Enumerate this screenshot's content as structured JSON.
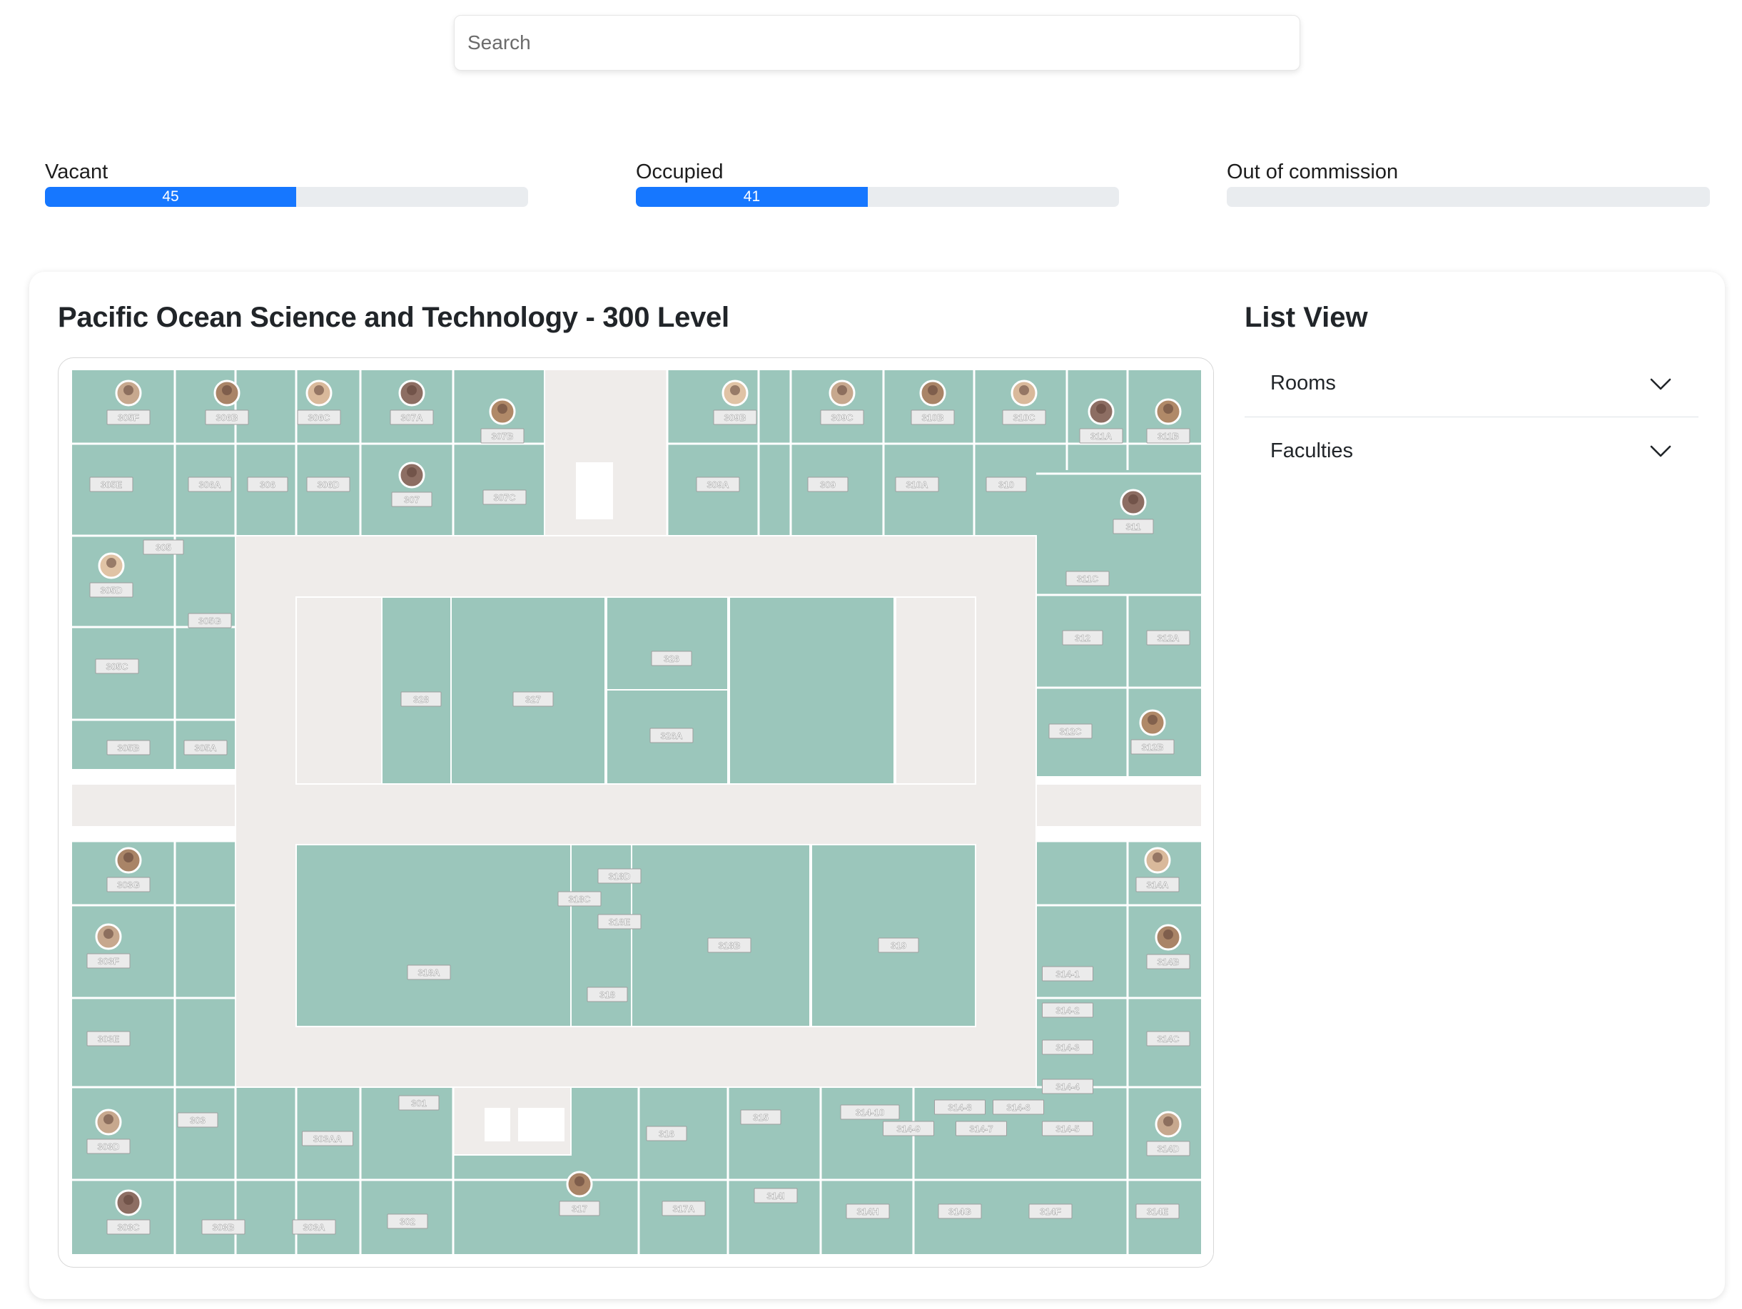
{
  "search": {
    "placeholder": "Search"
  },
  "stats": [
    {
      "label": "Vacant",
      "value": "45",
      "fraction": 0.52
    },
    {
      "label": "Occupied",
      "value": "41",
      "fraction": 0.48
    },
    {
      "label": "Out of commission",
      "value": "",
      "fraction": 0
    }
  ],
  "map": {
    "title": "Pacific Ocean Science and Technology - 300 Level"
  },
  "list_view": {
    "title": "List View",
    "items": [
      {
        "label": "Rooms"
      },
      {
        "label": "Faculties"
      }
    ]
  },
  "colors": {
    "room": "#9bc6bb",
    "corridor": "#efecea",
    "progress": "#1677ff",
    "track": "#e9ecef"
  },
  "rooms": [
    {
      "label": "305F",
      "avatar": true
    },
    {
      "label": "306B",
      "avatar": true
    },
    {
      "label": "306C",
      "avatar": true
    },
    {
      "label": "307A",
      "avatar": true
    },
    {
      "label": "307B",
      "avatar": true
    },
    {
      "label": "309B",
      "avatar": true
    },
    {
      "label": "309C",
      "avatar": true
    },
    {
      "label": "310B",
      "avatar": true
    },
    {
      "label": "310C",
      "avatar": true
    },
    {
      "label": "311A",
      "avatar": true
    },
    {
      "label": "311B",
      "avatar": true
    },
    {
      "label": "305E",
      "avatar": false
    },
    {
      "label": "306A",
      "avatar": false
    },
    {
      "label": "306",
      "avatar": false
    },
    {
      "label": "306D",
      "avatar": false
    },
    {
      "label": "307",
      "avatar": true
    },
    {
      "label": "307C",
      "avatar": false
    },
    {
      "label": "309A",
      "avatar": false
    },
    {
      "label": "309",
      "avatar": false
    },
    {
      "label": "310A",
      "avatar": false
    },
    {
      "label": "310",
      "avatar": false
    },
    {
      "label": "311",
      "avatar": true
    },
    {
      "label": "305",
      "avatar": false
    },
    {
      "label": "305D",
      "avatar": true
    },
    {
      "label": "311C",
      "avatar": false
    },
    {
      "label": "305G",
      "avatar": false
    },
    {
      "label": "312",
      "avatar": false
    },
    {
      "label": "312A",
      "avatar": false
    },
    {
      "label": "305C",
      "avatar": false
    },
    {
      "label": "326",
      "avatar": false
    },
    {
      "label": "328",
      "avatar": false
    },
    {
      "label": "327",
      "avatar": false
    },
    {
      "label": "326A",
      "avatar": false
    },
    {
      "label": "312C",
      "avatar": false
    },
    {
      "label": "312B",
      "avatar": true
    },
    {
      "label": "305B",
      "avatar": false
    },
    {
      "label": "305A",
      "avatar": false
    },
    {
      "label": "303G",
      "avatar": true
    },
    {
      "label": "314A",
      "avatar": true
    },
    {
      "label": "318D",
      "avatar": false
    },
    {
      "label": "318C",
      "avatar": false
    },
    {
      "label": "318E",
      "avatar": false
    },
    {
      "label": "303F",
      "avatar": true
    },
    {
      "label": "314B",
      "avatar": true
    },
    {
      "label": "318B",
      "avatar": false
    },
    {
      "label": "319",
      "avatar": false
    },
    {
      "label": "318A",
      "avatar": false
    },
    {
      "label": "314-1",
      "avatar": false
    },
    {
      "label": "318",
      "avatar": false
    },
    {
      "label": "314-2",
      "avatar": false
    },
    {
      "label": "303E",
      "avatar": false
    },
    {
      "label": "314C",
      "avatar": false
    },
    {
      "label": "314-3",
      "avatar": false
    },
    {
      "label": "314-4",
      "avatar": false
    },
    {
      "label": "301",
      "avatar": false
    },
    {
      "label": "314-10",
      "avatar": false
    },
    {
      "label": "314-8",
      "avatar": false
    },
    {
      "label": "314-6",
      "avatar": false
    },
    {
      "label": "303",
      "avatar": false
    },
    {
      "label": "315",
      "avatar": false
    },
    {
      "label": "303D",
      "avatar": true
    },
    {
      "label": "303AA",
      "avatar": false
    },
    {
      "label": "316",
      "avatar": false
    },
    {
      "label": "314-9",
      "avatar": false
    },
    {
      "label": "314-7",
      "avatar": false
    },
    {
      "label": "314-5",
      "avatar": false
    },
    {
      "label": "314D",
      "avatar": true
    },
    {
      "label": "317",
      "avatar": true
    },
    {
      "label": "314I",
      "avatar": false
    },
    {
      "label": "317A",
      "avatar": false
    },
    {
      "label": "302",
      "avatar": false
    },
    {
      "label": "314H",
      "avatar": false
    },
    {
      "label": "314G",
      "avatar": false
    },
    {
      "label": "314F",
      "avatar": false
    },
    {
      "label": "314E",
      "avatar": false
    },
    {
      "label": "303C",
      "avatar": true
    },
    {
      "label": "303B",
      "avatar": false
    },
    {
      "label": "303A",
      "avatar": false
    }
  ]
}
